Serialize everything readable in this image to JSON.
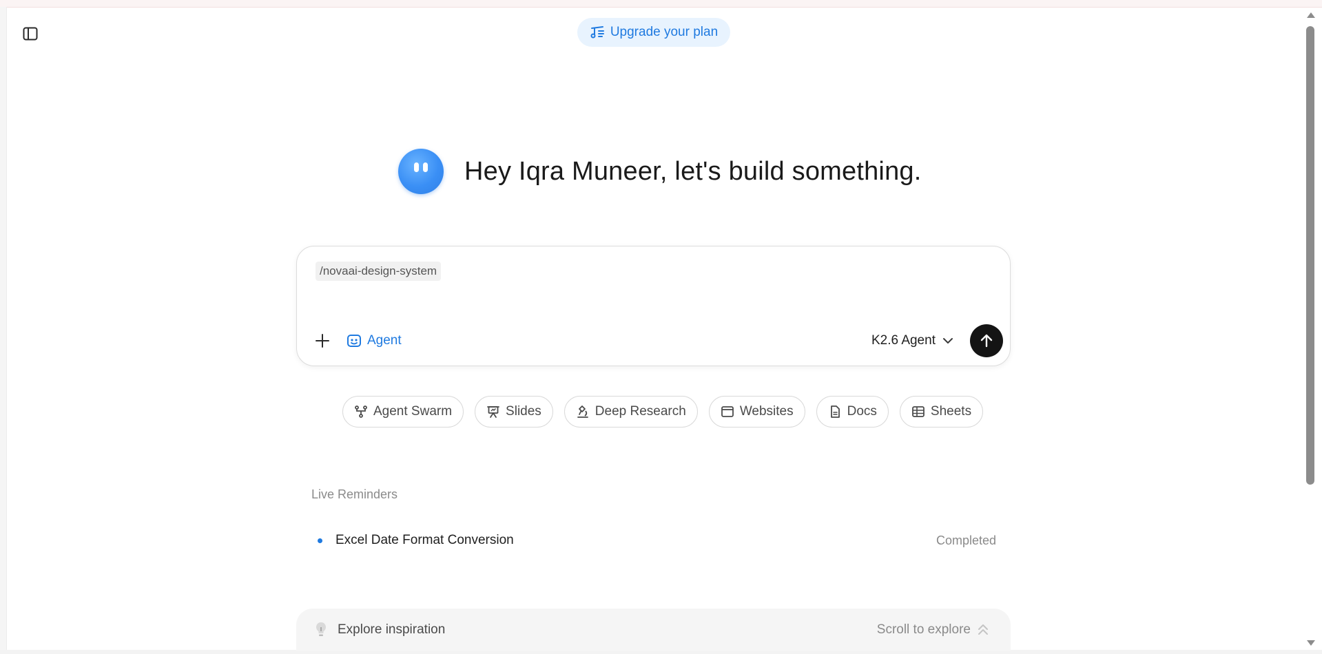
{
  "header": {
    "upgrade_label": "Upgrade your plan"
  },
  "hero": {
    "greeting": "Hey Iqra Muneer, let's build something."
  },
  "composer": {
    "command": "/novaai-design-system",
    "agent_label": "Agent",
    "model_label": "K2.6 Agent"
  },
  "shortcuts": [
    {
      "label": "Agent Swarm",
      "icon": "swarm-icon"
    },
    {
      "label": "Slides",
      "icon": "slides-icon"
    },
    {
      "label": "Deep Research",
      "icon": "microscope-icon"
    },
    {
      "label": "Websites",
      "icon": "browser-icon"
    },
    {
      "label": "Docs",
      "icon": "document-icon"
    },
    {
      "label": "Sheets",
      "icon": "table-icon"
    }
  ],
  "reminders": {
    "title": "Live Reminders",
    "items": [
      {
        "title": "Excel Date Format Conversion",
        "status": "Completed"
      }
    ]
  },
  "explore": {
    "label": "Explore inspiration",
    "hint": "Scroll to explore"
  },
  "colors": {
    "accent": "#1f7ae0",
    "accent_bg": "#e8f3fe",
    "send": "#141414"
  }
}
